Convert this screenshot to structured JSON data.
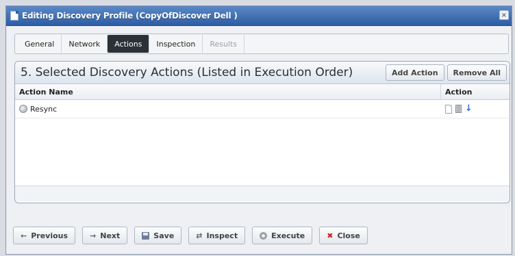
{
  "window": {
    "title": "Editing Discovery Profile (CopyOfDiscover Dell )",
    "close_glyph": "×"
  },
  "tabs": [
    {
      "label": "General",
      "state": "normal"
    },
    {
      "label": "Network",
      "state": "normal"
    },
    {
      "label": "Actions",
      "state": "active"
    },
    {
      "label": "Inspection",
      "state": "normal"
    },
    {
      "label": "Results",
      "state": "disabled"
    }
  ],
  "panel": {
    "title": "5. Selected Discovery Actions (Listed in Execution Order)",
    "add_action_label": "Add Action",
    "remove_all_label": "Remove All",
    "columns": {
      "name": "Action Name",
      "action": "Action"
    },
    "rows": [
      {
        "name": "Resync",
        "icon": "gear-icon",
        "actions": [
          "edit-document-icon",
          "delete-trash-icon",
          "move-down-arrow-icon"
        ]
      }
    ]
  },
  "footer": {
    "buttons": [
      {
        "label": "Previous",
        "glyph": "←",
        "icon": "arrow-left-icon"
      },
      {
        "label": "Next",
        "glyph": "→",
        "icon": "arrow-right-icon"
      },
      {
        "label": "Save",
        "glyph": "",
        "icon": "disk-icon"
      },
      {
        "label": "Inspect",
        "glyph": "⇄",
        "icon": "inspect-icon"
      },
      {
        "label": "Execute",
        "glyph": "",
        "icon": "gear-icon"
      },
      {
        "label": "Close",
        "glyph": "✖",
        "icon": "close-icon"
      }
    ]
  },
  "colors": {
    "titlebar": "#2d5da3",
    "active_tab": "#2c3138",
    "arrow_blue": "#2e6fd1",
    "close_red": "#c0282a"
  }
}
